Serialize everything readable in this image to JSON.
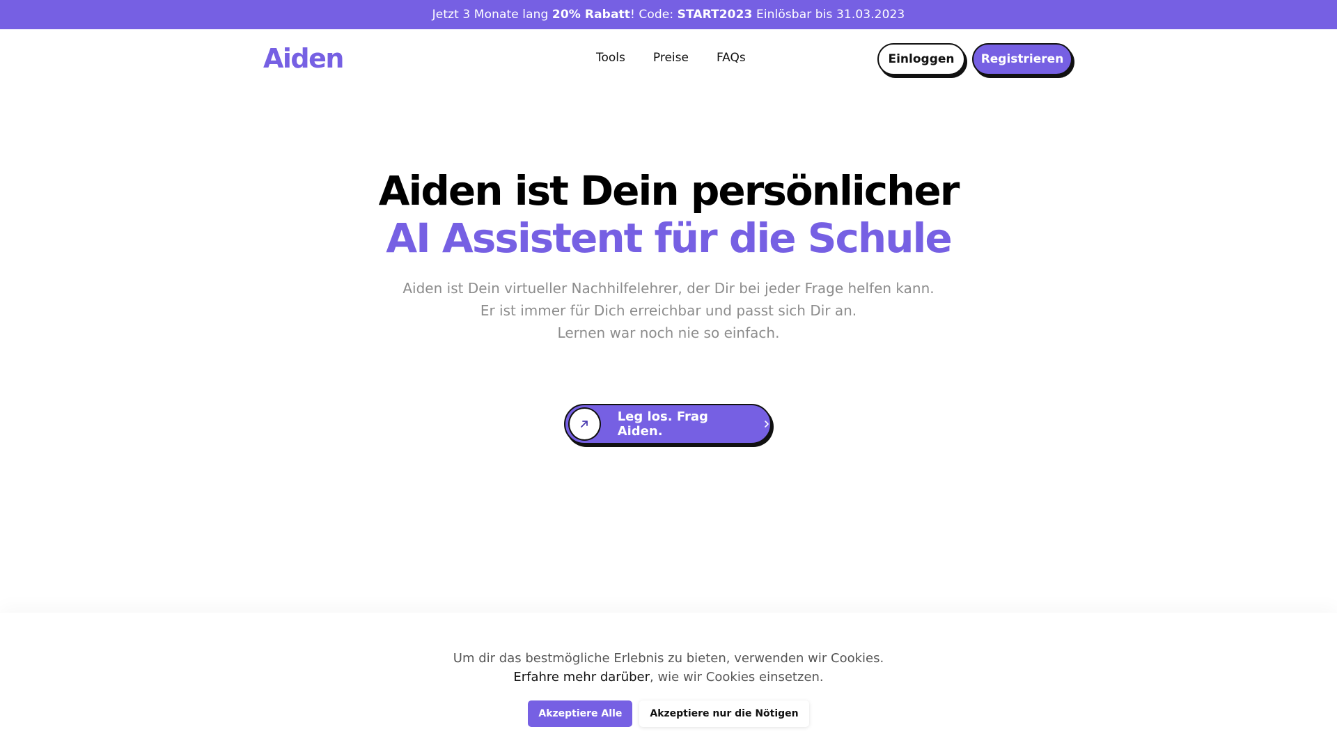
{
  "colors": {
    "brand": "#7660e3",
    "ink": "#111111",
    "muted": "#8c8c8c"
  },
  "promo": {
    "part1": "Jetzt 3 Monate lang ",
    "discount": "20% Rabatt",
    "part2": "! Code: ",
    "code": "START2023",
    "part3": " Einlösbar bis 31.03.2023"
  },
  "header": {
    "logo": "Aiden",
    "nav": [
      "Tools",
      "Preise",
      "FAQs"
    ],
    "login_label": "Einloggen",
    "register_label": "Registrieren"
  },
  "hero": {
    "title_line1": "Aiden ist Dein persönlicher",
    "title_line2": "AI Assistent für die Schule",
    "subtitle": [
      "Aiden ist Dein virtueller Nachhilfelehrer, der Dir bei jeder Frage helfen kann.",
      "Er ist immer für Dich erreichbar und passt sich Dir an.",
      "Lernen war noch nie so einfach."
    ],
    "cta_label": "Leg los. Frag Aiden.",
    "cta_icon": "arrow-up-right-icon",
    "cta_chevron_icon": "chevron-right-icon"
  },
  "cookie": {
    "line1": "Um dir das bestmögliche Erlebnis zu bieten, verwenden wir Cookies.",
    "learn_more": "Erfahre mehr darüber",
    "line2_rest": ", wie wir Cookies einsetzen.",
    "accept_all": "Akzeptiere Alle",
    "accept_necessary": "Akzeptiere nur die Nötigen"
  }
}
